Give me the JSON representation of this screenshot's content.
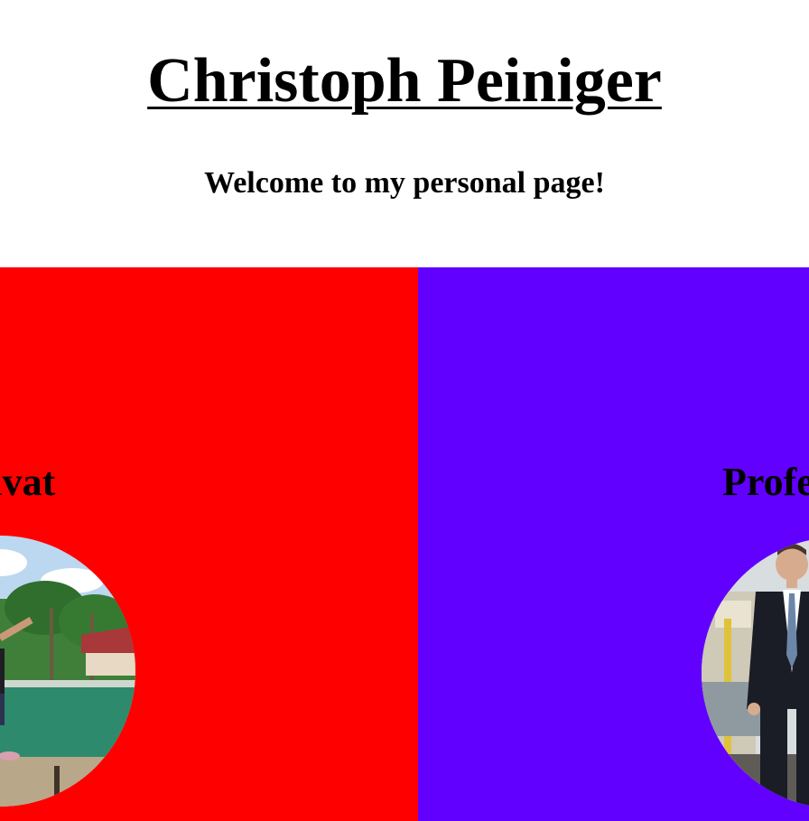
{
  "header": {
    "title": "Christoph Peiniger",
    "subtitle": "Welcome to my personal page!"
  },
  "panels": [
    {
      "label": "Privat",
      "color": "#ff0000",
      "photo_icon": "vacation-photo"
    },
    {
      "label": "Professionell",
      "color": "#6200ff",
      "photo_icon": "business-photo"
    }
  ]
}
